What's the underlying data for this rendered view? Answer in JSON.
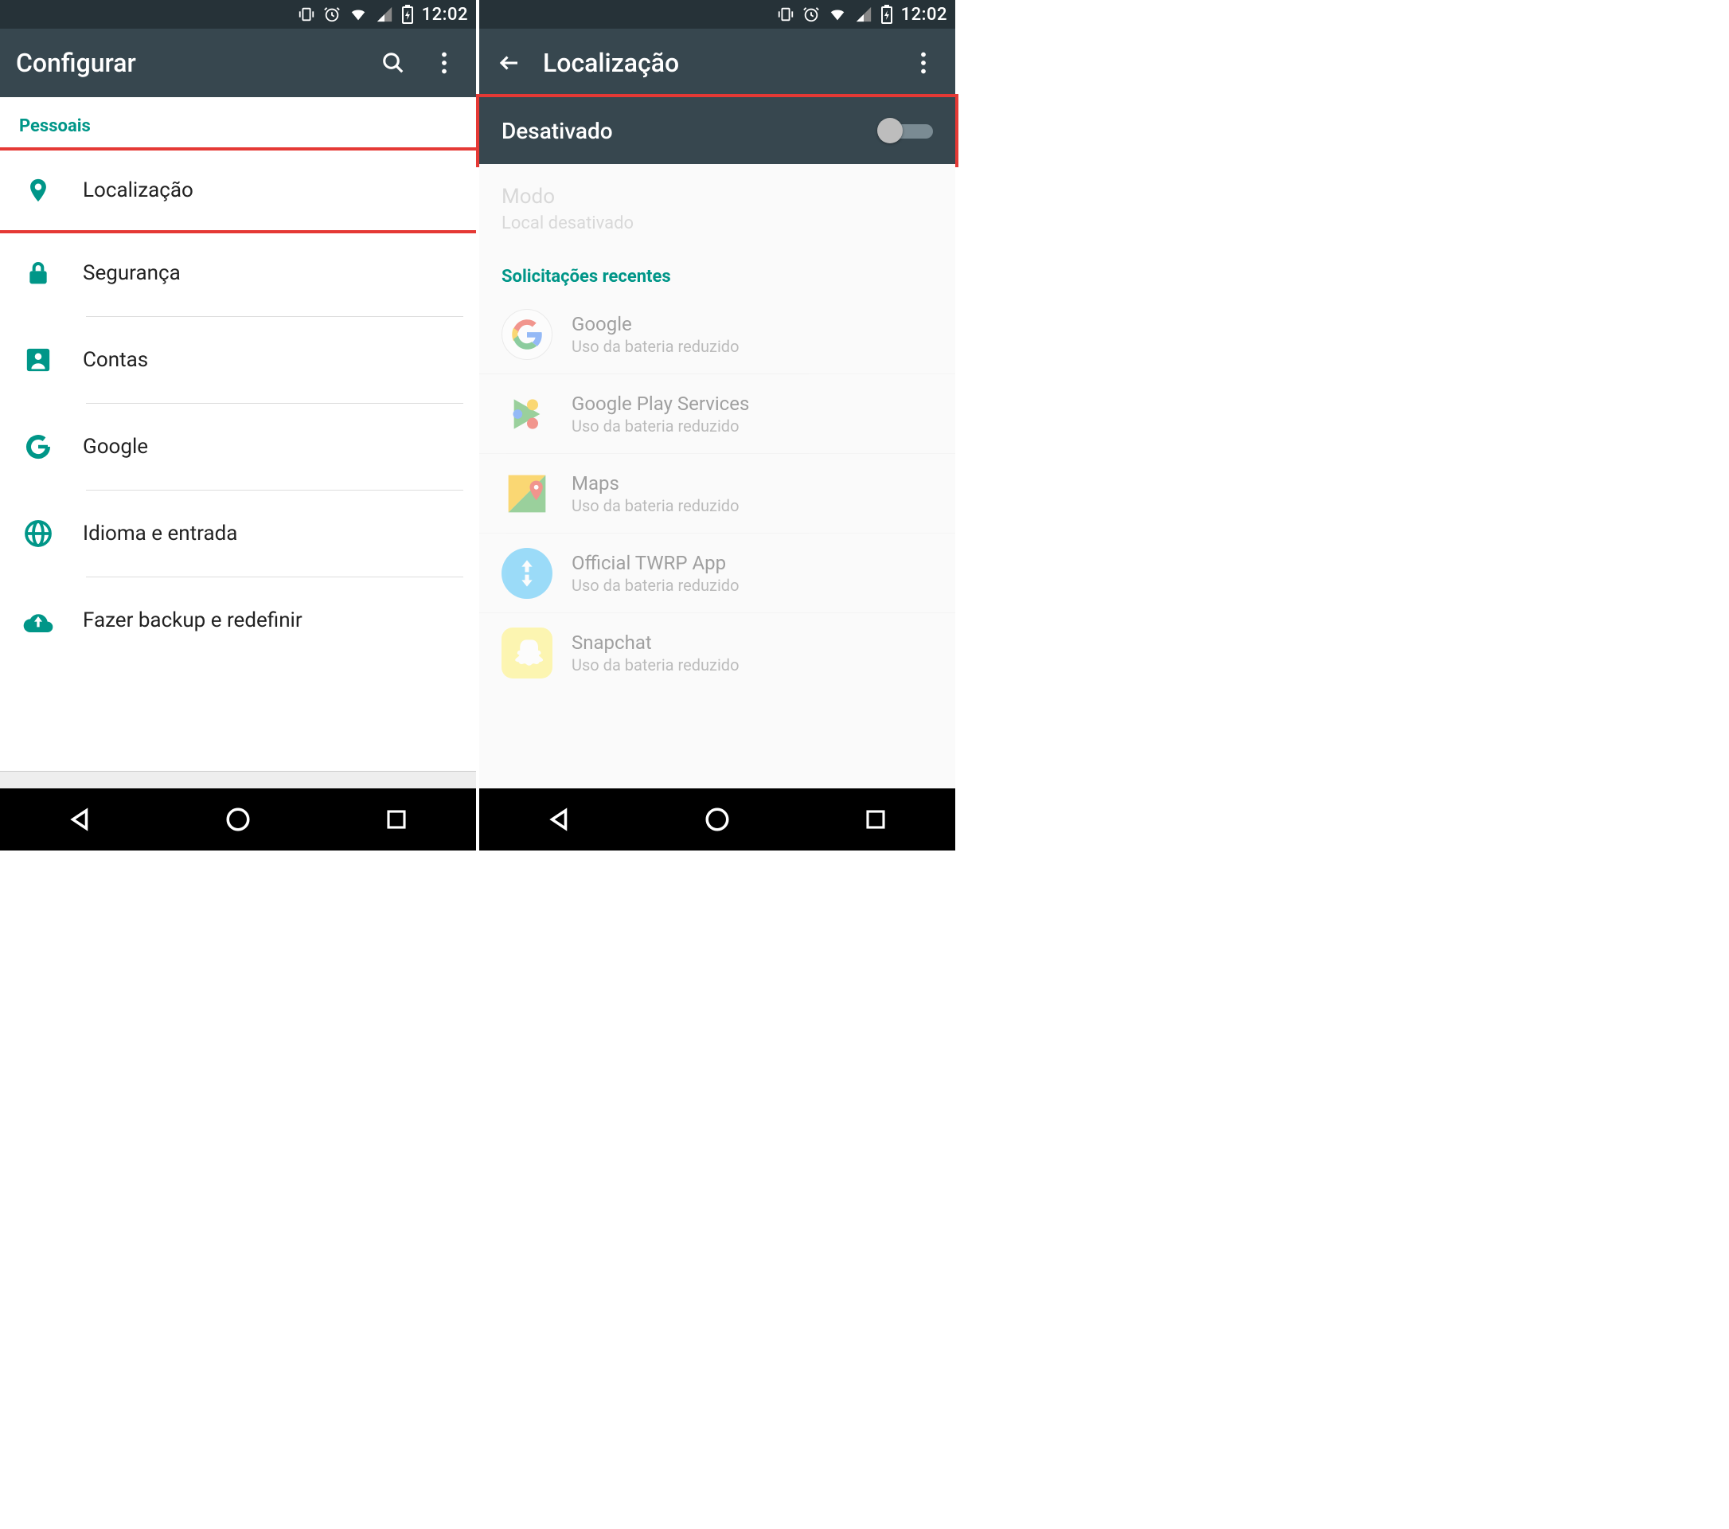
{
  "status": {
    "time": "12:02"
  },
  "left": {
    "appbar_title": "Configurar",
    "section": "Pessoais",
    "items": [
      {
        "label": "Localização"
      },
      {
        "label": "Segurança"
      },
      {
        "label": "Contas"
      },
      {
        "label": "Google"
      },
      {
        "label": "Idioma e entrada"
      },
      {
        "label": "Fazer backup e redefinir"
      }
    ]
  },
  "right": {
    "appbar_title": "Localização",
    "toggle_label": "Desativado",
    "mode_title": "Modo",
    "mode_sub": "Local desativado",
    "recent_header": "Solicitações recentes",
    "apps": [
      {
        "name": "Google",
        "sub": "Uso da bateria reduzido"
      },
      {
        "name": "Google Play Services",
        "sub": "Uso da bateria reduzido"
      },
      {
        "name": "Maps",
        "sub": "Uso da bateria reduzido"
      },
      {
        "name": "Official TWRP App",
        "sub": "Uso da bateria reduzido"
      },
      {
        "name": "Snapchat",
        "sub": "Uso da bateria reduzido"
      }
    ]
  }
}
